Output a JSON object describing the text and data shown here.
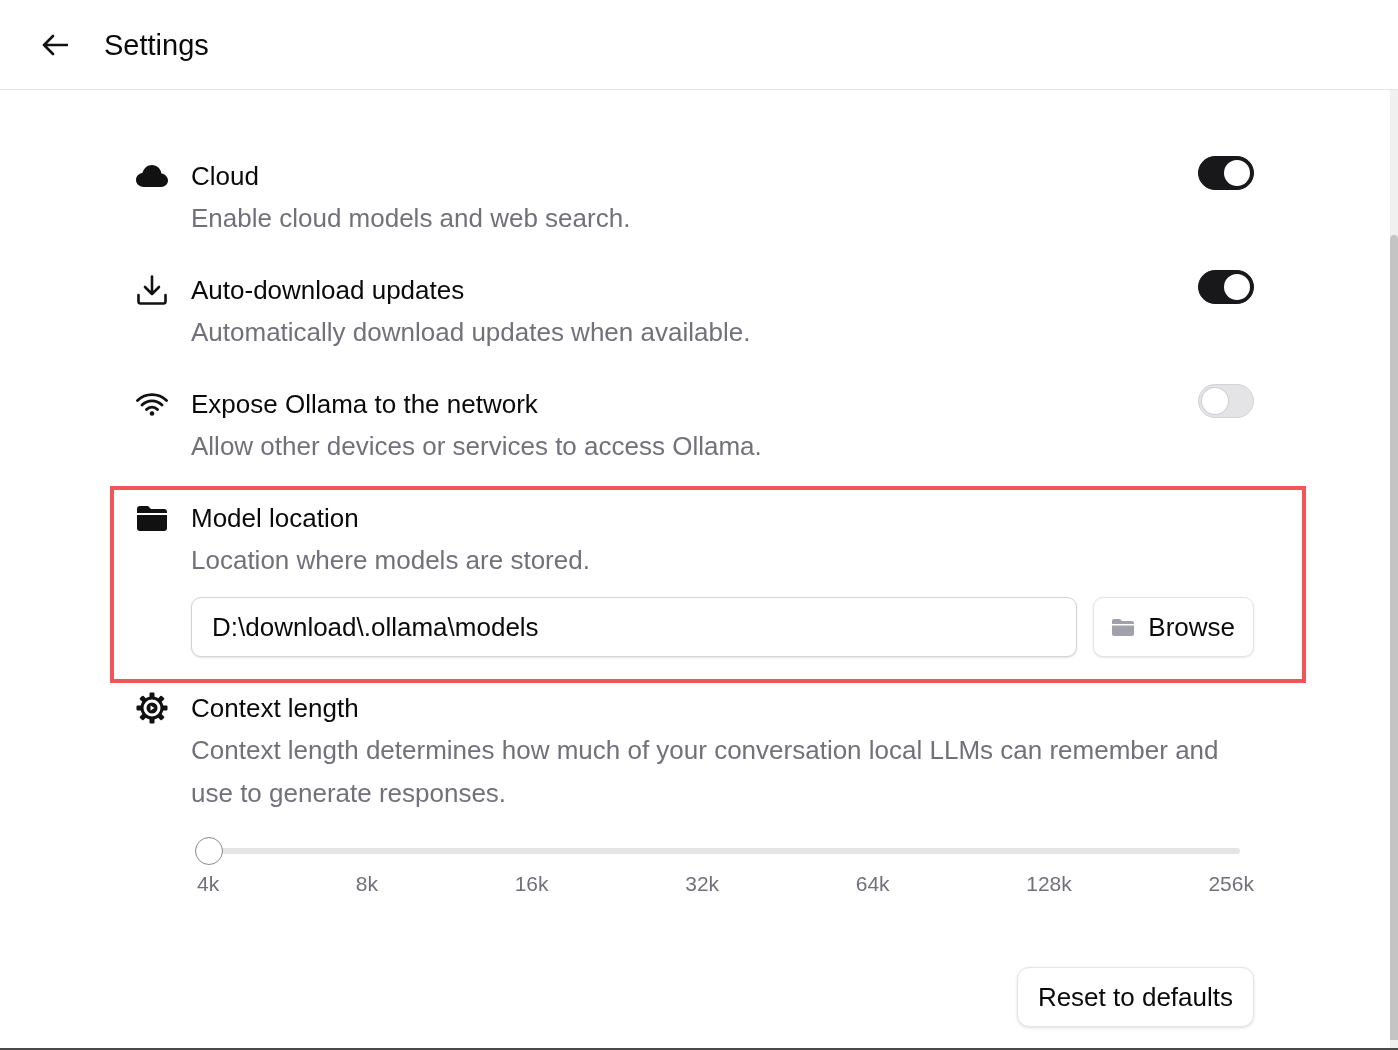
{
  "header": {
    "title": "Settings"
  },
  "settings": [
    {
      "kind": "toggle",
      "title": "Cloud",
      "description": "Enable cloud models and web search.",
      "on": true,
      "highlighted": false
    },
    {
      "kind": "toggle",
      "title": "Auto-download updates",
      "description": "Automatically download updates when available.",
      "on": true,
      "highlighted": false
    },
    {
      "kind": "toggle",
      "title": "Expose Ollama to the network",
      "description": "Allow other devices or services to access Ollama.",
      "on": false,
      "highlighted": false
    },
    {
      "kind": "path",
      "title": "Model location",
      "description": "Location where models are stored.",
      "value": "D:\\download\\.ollama\\models",
      "button": "Browse",
      "highlighted": true
    },
    {
      "kind": "slider",
      "title": "Context length",
      "description": "Context length determines how much of your conversation local LLMs can remember and use to generate responses.",
      "level": 0,
      "ticks": [
        "4k",
        "8k",
        "16k",
        "32k",
        "64k",
        "128k",
        "256k"
      ],
      "highlighted": false
    }
  ],
  "footer": {
    "reset_button": "Reset to defaults"
  }
}
